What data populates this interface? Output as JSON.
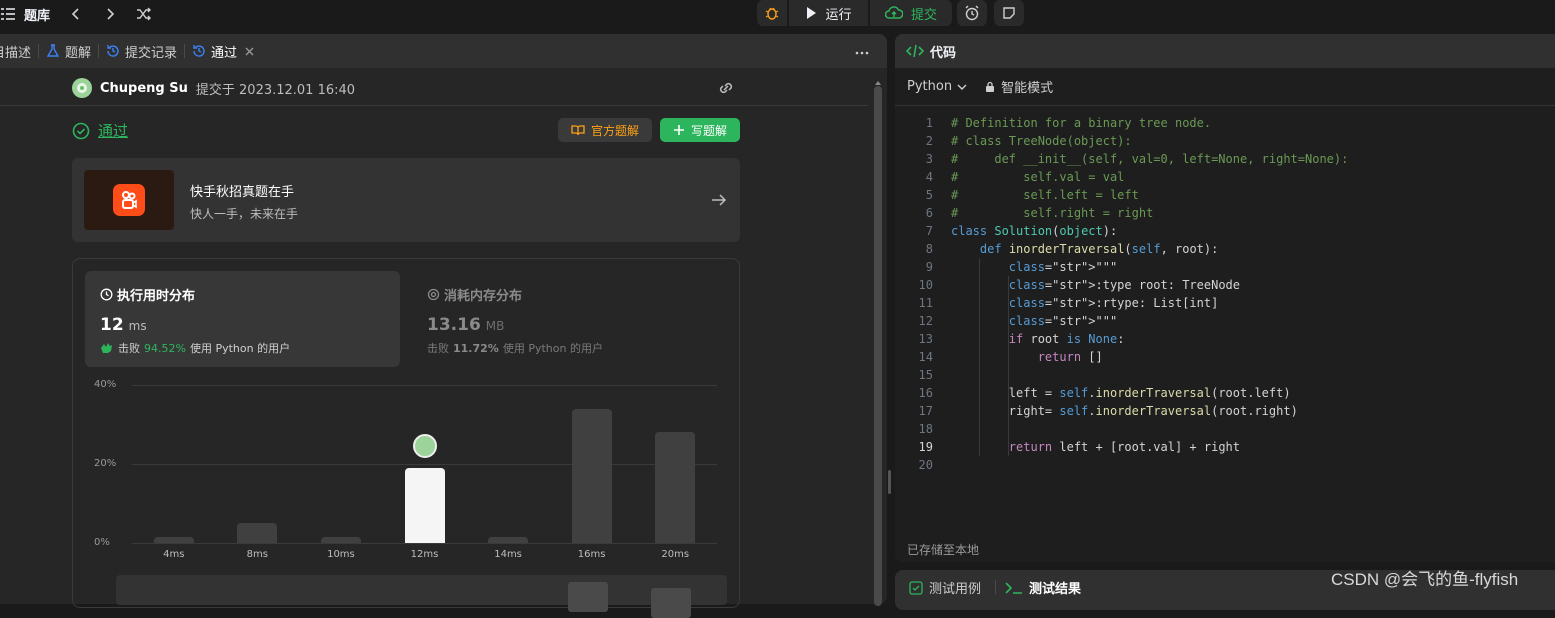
{
  "topbar": {
    "problem_bank": "题库",
    "run_label": "运行",
    "submit_label": "提交"
  },
  "left_tabs": [
    {
      "label": "目描述"
    },
    {
      "label": "题解"
    },
    {
      "label": "提交记录"
    },
    {
      "label": "通过"
    }
  ],
  "submission": {
    "user": "Chupeng Su",
    "submitted_text": "提交于 2023.12.01 16:40",
    "status": "通过",
    "official_solution": "官方题解",
    "write_solution": "写题解"
  },
  "promo": {
    "title": "快手秋招真题在手",
    "subtitle": "快人一手，未来在手"
  },
  "stats": {
    "runtime": {
      "title": "执行用时分布",
      "value": "12",
      "unit": "ms",
      "beats_label": "击败",
      "beats_pct": "94.52%",
      "beats_suffix": "使用 Python 的用户"
    },
    "memory": {
      "title": "消耗内存分布",
      "value": "13.16",
      "unit": "MB",
      "beats_label": "击败",
      "beats_pct": "11.72%",
      "beats_suffix": "使用 Python 的用户"
    }
  },
  "chart_data": {
    "type": "bar",
    "categories": [
      "4ms",
      "8ms",
      "10ms",
      "12ms",
      "14ms",
      "16ms",
      "20ms"
    ],
    "values": [
      1.5,
      5,
      1.5,
      19,
      1.5,
      34,
      28
    ],
    "highlight_index": 3,
    "ylim": [
      0,
      40
    ],
    "yticks": [
      "0%",
      "20%",
      "40%"
    ],
    "grid": true
  },
  "editor": {
    "title": "代码",
    "language": "Python",
    "mode": "智能模式",
    "saved_text": "已存储至本地",
    "current_line": 19,
    "lines": [
      "# Definition for a binary tree node.",
      "# class TreeNode(object):",
      "#     def __init__(self, val=0, left=None, right=None):",
      "#         self.val = val",
      "#         self.left = left",
      "#         self.right = right",
      "class Solution(object):",
      "    def inorderTraversal(self, root):",
      "        \"\"\"",
      "        :type root: TreeNode",
      "        :rtype: List[int]",
      "        \"\"\"",
      "        if root is None:",
      "            return []",
      "",
      "        left = self.inorderTraversal(root.left)",
      "        right= self.inorderTraversal(root.right)",
      "",
      "        return left + [root.val] + right",
      ""
    ]
  },
  "bottom_tabs": {
    "test_case": "测试用例",
    "test_result": "测试结果"
  },
  "watermark": "CSDN @会飞的鱼-flyfish",
  "colors": {
    "accent_green": "#2db55d",
    "orange": "#ffa116",
    "bg": "#1a1a1a",
    "panel": "#262626"
  }
}
